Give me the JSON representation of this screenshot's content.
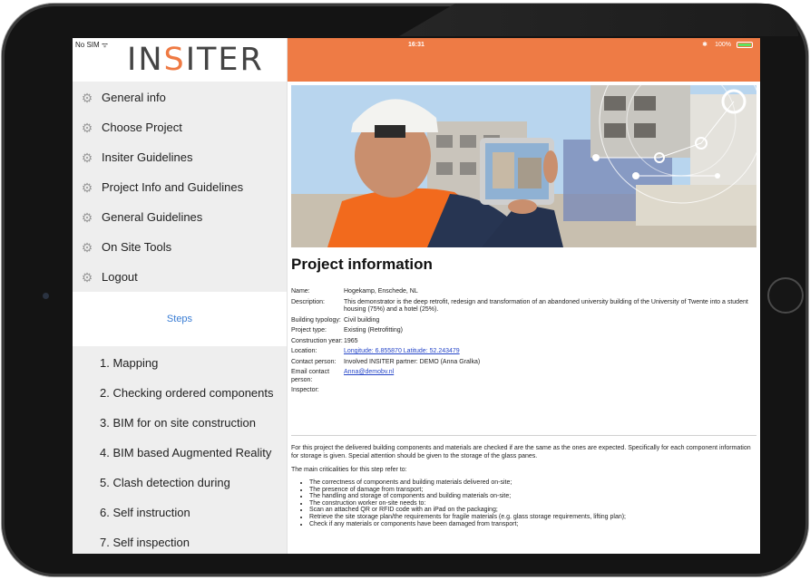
{
  "sidebar": {
    "carrier": "No SIM",
    "logo": {
      "prefix": "IN",
      "accent": "S",
      "suffix": "ITER"
    },
    "menu_items": [
      {
        "label": "General info"
      },
      {
        "label": "Choose Project"
      },
      {
        "label": "Insiter Guidelines"
      },
      {
        "label": "Project Info and Guidelines"
      },
      {
        "label": "General Guidelines"
      },
      {
        "label": "On Site Tools"
      },
      {
        "label": "Logout"
      }
    ],
    "steps_title": "Steps",
    "steps": [
      {
        "label": "1. Mapping"
      },
      {
        "label": "2. Checking ordered components"
      },
      {
        "label": "3. BIM for on site construction"
      },
      {
        "label": "4. BIM based Augmented Reality"
      },
      {
        "label": "5. Clash detection during"
      },
      {
        "label": "6. Self instruction"
      },
      {
        "label": "7. Self inspection"
      }
    ]
  },
  "status_bar": {
    "time": "16:31",
    "battery": "100%"
  },
  "content": {
    "title": "Project information",
    "info": [
      {
        "label": "Name:",
        "value": "Hogekamp, Enschede, NL"
      },
      {
        "label": "Description:",
        "value": "This demonstrator is the deep retrofit, redesign and transformation of an abandoned university building of the University of Twente into a student housing (75%) and a hotel (25%)."
      },
      {
        "label": "Building typology:",
        "value": "Civil building"
      },
      {
        "label": "Project type:",
        "value": "Existing (Retrofitting)"
      },
      {
        "label": "Construction year:",
        "value": "1965"
      },
      {
        "label": "Location:",
        "value": "Longitude: 6.855870 Latitude: 52.243479",
        "link": true
      },
      {
        "label": "Contact person:",
        "value": "Involved INSITER partner: DEMO (Anna Gralka)"
      },
      {
        "label": "Email contact person:",
        "value": "Anna@demobv.nl",
        "link": true
      },
      {
        "label": "Inspector:",
        "value": ""
      }
    ],
    "paragraph1": "For this project the delivered building components and materials are checked if are the same as the ones are expected. Specifically for each component information for storage is given. Special attention should be given to the storage of the glass panes.",
    "paragraph2": "The main criticalities for this step refer to:",
    "bullets": [
      "The correctness of components and building materials delivered on-site;",
      "The presence of damage from transport;",
      "The handling and storage of components and building materials on-site;",
      "The construction worker on-site needs to:",
      "Scan an attached QR or RFID code with an iPad on the packaging;",
      "Retrieve the site storage plan/the requirements for fragile materials (e.g. glass storage requirements, lifting plan);",
      "Check if any materials or components have been damaged from transport;"
    ]
  },
  "colors": {
    "accent": "#ee7b45",
    "steps_title": "#3a7dd4",
    "sidebar_bg": "#eeeeee",
    "link": "#2646c8"
  }
}
